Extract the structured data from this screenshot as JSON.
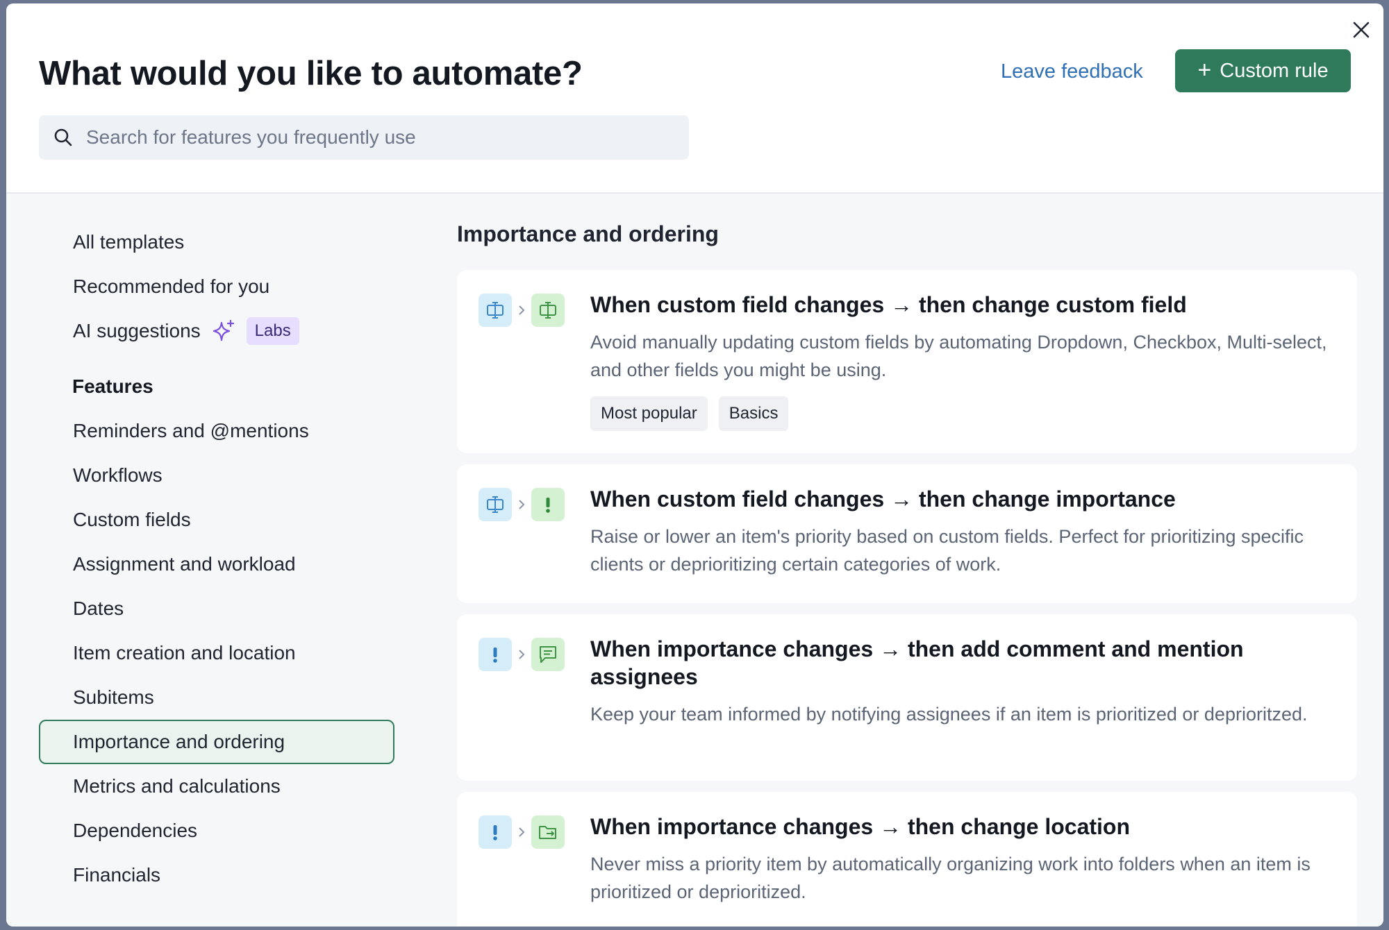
{
  "header": {
    "title": "What would you like to automate?",
    "feedback_label": "Leave feedback",
    "custom_rule_label": "Custom rule"
  },
  "search": {
    "placeholder": "Search for features you frequently use",
    "value": ""
  },
  "sidebar": {
    "top_items": [
      {
        "label": "All templates"
      },
      {
        "label": "Recommended for you"
      },
      {
        "label": "AI suggestions",
        "badge": "Labs"
      }
    ],
    "features_heading": "Features",
    "features": [
      {
        "label": "Reminders and @mentions"
      },
      {
        "label": "Workflows"
      },
      {
        "label": "Custom fields"
      },
      {
        "label": "Assignment and workload"
      },
      {
        "label": "Dates"
      },
      {
        "label": "Item creation and location"
      },
      {
        "label": "Subitems"
      },
      {
        "label": "Importance and ordering",
        "active": true
      },
      {
        "label": "Metrics and calculations"
      },
      {
        "label": "Dependencies"
      },
      {
        "label": "Financials"
      }
    ]
  },
  "main": {
    "section_title": "Importance and ordering",
    "cards": [
      {
        "title": "When custom field changes → then change custom field",
        "description": "Avoid manually updating custom fields by automating Dropdown, Checkbox, Multi-select, and other fields you might be using.",
        "tags": [
          "Most popular",
          "Basics"
        ],
        "trigger_icon": "custom-field-icon",
        "action_icon": "custom-field-icon"
      },
      {
        "title": "When custom field changes → then change importance",
        "description": "Raise or lower an item's priority based on custom fields. Perfect for prioritizing specific clients or deprioritizing certain categories of work.",
        "tags": [],
        "trigger_icon": "custom-field-icon",
        "action_icon": "importance-icon"
      },
      {
        "title": "When importance changes → then add comment and mention assignees",
        "description": "Keep your team informed by notifying assignees if an item is prioritized or deprioritzed.",
        "tags": [],
        "trigger_icon": "importance-icon",
        "action_icon": "comment-icon"
      },
      {
        "title": "When importance changes → then change location",
        "description": "Never miss a priority item by automatically organizing work into folders when an item is prioritized or deprioritized.",
        "tags": [],
        "trigger_icon": "importance-icon",
        "action_icon": "folder-move-icon"
      }
    ]
  },
  "colors": {
    "accent_green": "#2e7a5a",
    "link_blue": "#2f6fb5",
    "labs_purple": "#e6ddff",
    "icon_blue_bg": "#d5ecf9",
    "icon_green_bg": "#d4f1d1"
  }
}
